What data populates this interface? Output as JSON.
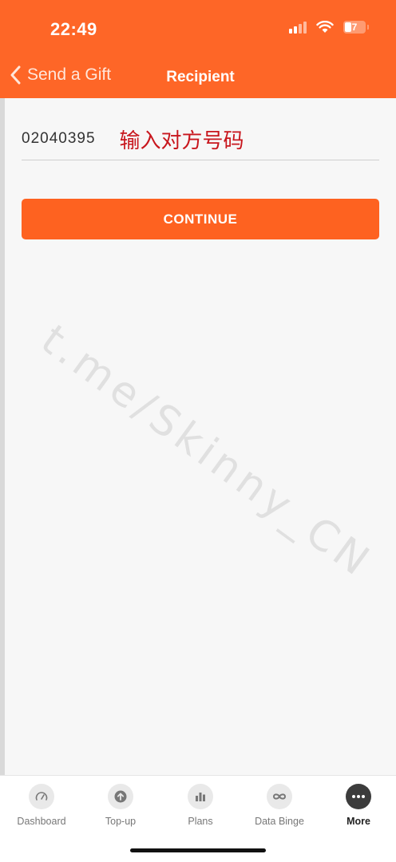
{
  "status_bar": {
    "time": "22:49",
    "battery": "7"
  },
  "nav": {
    "back_label": "Send a Gift",
    "title": "Recipient"
  },
  "form": {
    "phone_value": "02040395",
    "annotation": "输入对方号码",
    "continue_label": "CONTINUE"
  },
  "watermark": "t.me/Skinny_CN",
  "tabs": [
    {
      "label": "Dashboard",
      "icon": "gauge-icon",
      "active": false
    },
    {
      "label": "Top-up",
      "icon": "arrow-up-circle-icon",
      "active": false
    },
    {
      "label": "Plans",
      "icon": "bar-chart-icon",
      "active": false
    },
    {
      "label": "Data Binge",
      "icon": "infinity-icon",
      "active": false
    },
    {
      "label": "More",
      "icon": "more-dots-icon",
      "active": true
    }
  ],
  "colors": {
    "brand_orange": "#fe6627",
    "button_orange": "#fe6220",
    "annotation_red": "#c8161d"
  }
}
